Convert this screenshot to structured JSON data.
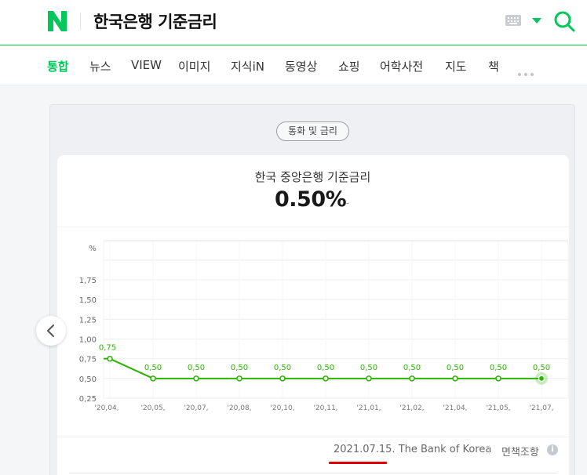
{
  "header": {
    "logo_letter": "N",
    "query": "한국은행 기준금리",
    "brand_color": "#03c75a"
  },
  "tabs": [
    {
      "label": "통합",
      "active": true
    },
    {
      "label": "뉴스"
    },
    {
      "label": "VIEW"
    },
    {
      "label": "이미지"
    },
    {
      "label": "지식iN"
    },
    {
      "label": "동영상"
    },
    {
      "label": "쇼핑"
    },
    {
      "label": "어학사전"
    },
    {
      "label": "지도"
    },
    {
      "label": "책"
    }
  ],
  "card": {
    "badge": "통화 및 금리",
    "rate_title": "한국 중앙은행 기준금리",
    "rate_value": "0.50%",
    "rate_change": "-",
    "source": "2021.07.15. The Bank of Korea",
    "disclaimer": "면책조항",
    "info_icon": "i"
  },
  "chart_data": {
    "type": "line",
    "ylabel": "%",
    "ylim": [
      0.25,
      1.75
    ],
    "yticks": [
      "1,75",
      "1,50",
      "1,25",
      "1,00",
      "0,75",
      "0,50",
      "0,25"
    ],
    "categories": [
      "'20,04,",
      "'20,05,",
      "'20,07,",
      "'20,08,",
      "'20,10,",
      "'20,11,",
      "'21,01,",
      "'21,02,",
      "'21,04,",
      "'21,05,",
      "'21,07,"
    ],
    "values": [
      0.75,
      0.5,
      0.5,
      0.5,
      0.5,
      0.5,
      0.5,
      0.5,
      0.5,
      0.5,
      0.5
    ],
    "labels": [
      "0,75",
      "0,50",
      "0,50",
      "0,50",
      "0,50",
      "0,50",
      "0,50",
      "0,50",
      "0,50",
      "0,50",
      "0,50"
    ],
    "line_color": "#2db400",
    "grid": true
  }
}
